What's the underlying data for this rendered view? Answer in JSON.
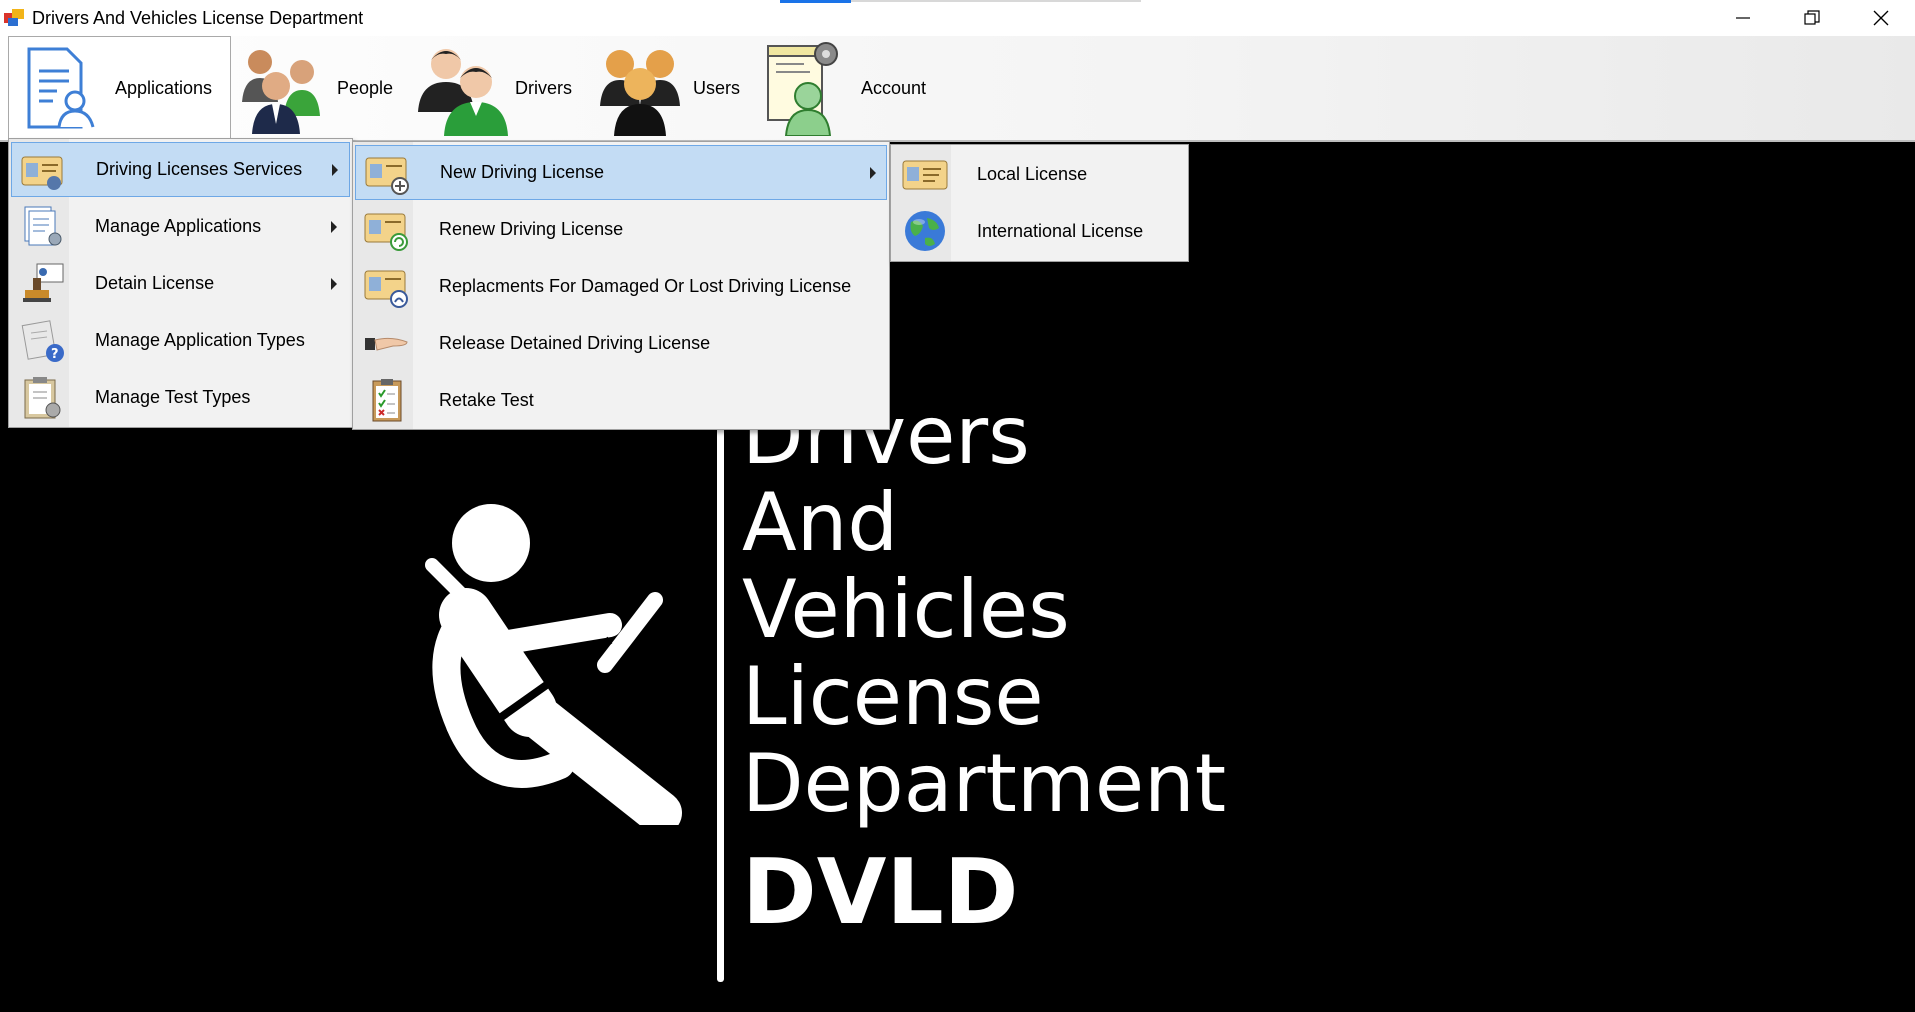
{
  "window": {
    "title": "Drivers And Vehicles License Department",
    "controls": [
      "minimize",
      "restore",
      "close"
    ]
  },
  "menubar": {
    "items": [
      {
        "label": "Applications",
        "icon": "applications-icon",
        "active": true
      },
      {
        "label": "People",
        "icon": "people-icon"
      },
      {
        "label": "Drivers",
        "icon": "drivers-icon"
      },
      {
        "label": "Users",
        "icon": "users-icon"
      },
      {
        "label": "Account",
        "icon": "account-icon"
      }
    ]
  },
  "applications_menu": {
    "items": [
      {
        "label": "Driving Licenses Services",
        "icon": "license-card-icon",
        "submenu": true,
        "highlighted": true
      },
      {
        "label": "Manage Applications",
        "icon": "documents-gear-icon",
        "submenu": true
      },
      {
        "label": "Detain License",
        "icon": "stamp-icon",
        "submenu": true
      },
      {
        "label": "Manage Application Types",
        "icon": "document-question-icon",
        "submenu": false
      },
      {
        "label": "Manage Test Types",
        "icon": "clipboard-gear-icon",
        "submenu": false
      }
    ]
  },
  "driving_services_menu": {
    "items": [
      {
        "label": "New Driving License",
        "icon": "license-add-icon",
        "submenu": true,
        "highlighted": true
      },
      {
        "label": "Renew Driving License",
        "icon": "license-renew-icon",
        "submenu": false
      },
      {
        "label": "Replacments For Damaged Or Lost Driving License",
        "icon": "license-replace-icon",
        "submenu": false
      },
      {
        "label": "Release Detained Driving License",
        "icon": "release-hand-icon",
        "submenu": false
      },
      {
        "label": "Retake Test",
        "icon": "checklist-icon",
        "submenu": false
      }
    ]
  },
  "new_license_menu": {
    "items": [
      {
        "label": "Local License",
        "icon": "license-card-icon"
      },
      {
        "label": "International License",
        "icon": "globe-icon"
      }
    ]
  },
  "background": {
    "logo_lines": [
      "Drivers",
      "And",
      "Vehicles",
      "License",
      "Department"
    ],
    "acronym": "DVLD"
  },
  "colors": {
    "menu_highlight": "#c3dcf4",
    "menu_highlight_border": "#6ea8e6",
    "background": "#000000",
    "logo": "#ffffff"
  }
}
